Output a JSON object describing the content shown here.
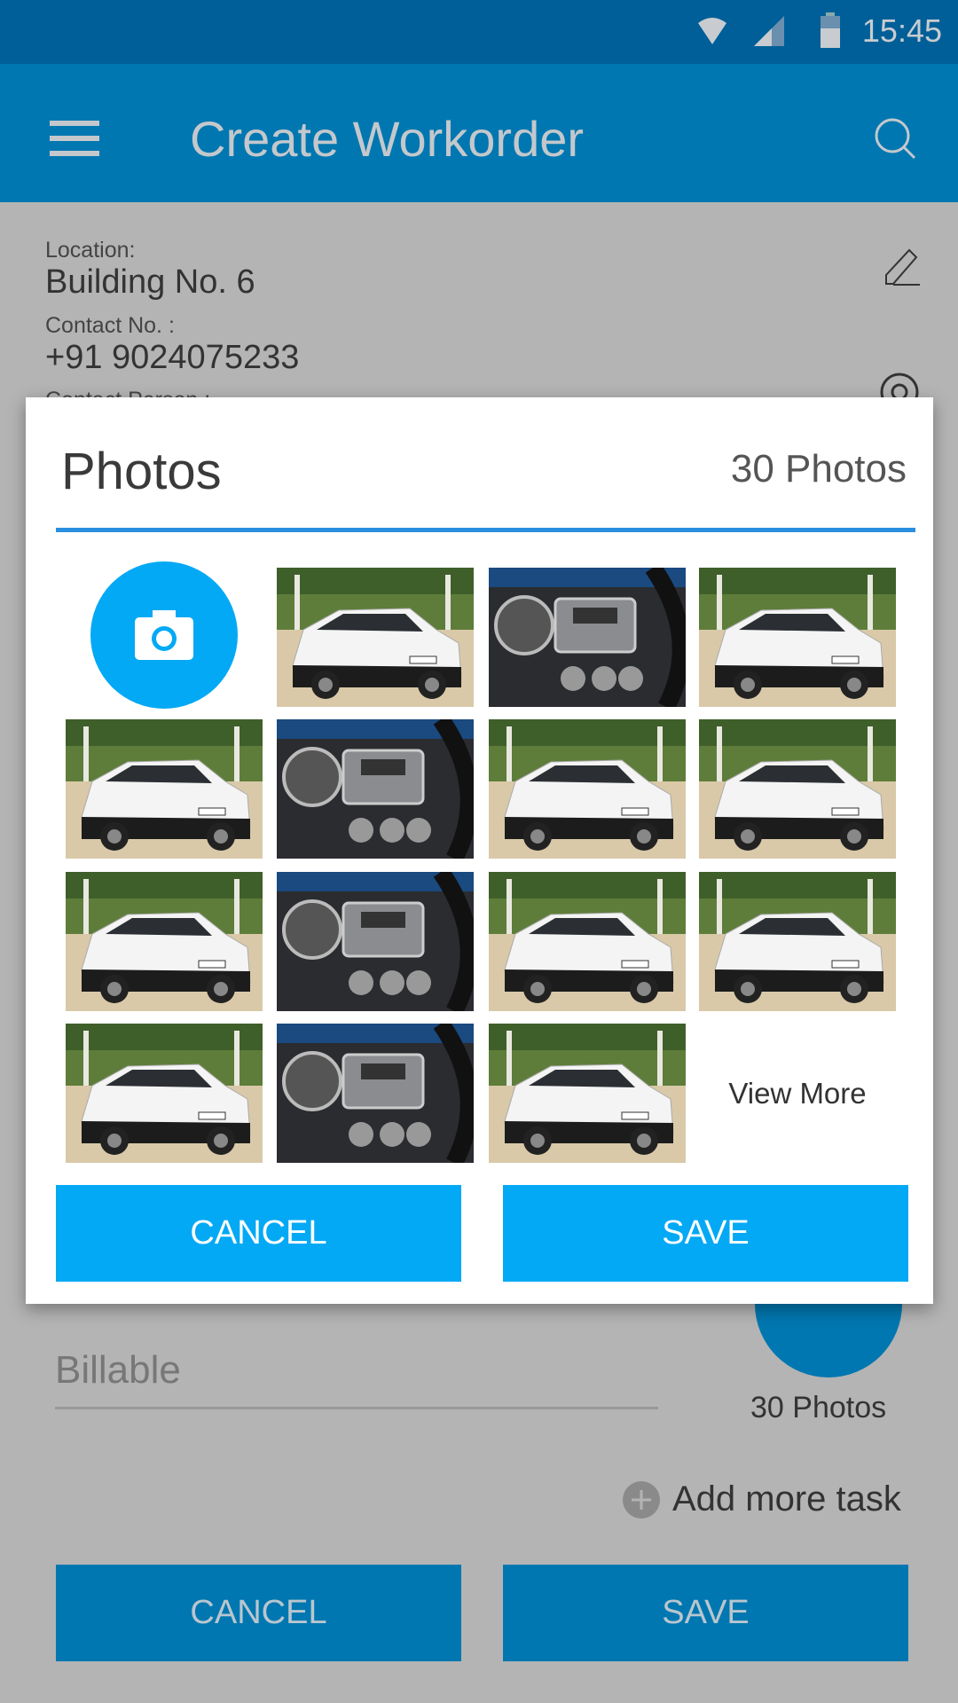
{
  "status_bar": {
    "time": "15:45",
    "icons": [
      "wifi-icon",
      "signal-icon",
      "battery-icon"
    ]
  },
  "app_bar": {
    "title": "Create Workorder",
    "menu_icon": "hamburger-menu-icon",
    "search_icon": "search-icon"
  },
  "details": {
    "location_label": "Location:",
    "location_value": "Building No. 6",
    "contact_no_label": "Contact No. :",
    "contact_no_value": "+91 9024075233",
    "contact_person_label": "Contact Person :"
  },
  "form": {
    "billable_placeholder": "Billable",
    "photos_count": "30 Photos",
    "add_task": "Add more task",
    "cancel": "CANCEL",
    "save": "SAVE"
  },
  "dialog": {
    "title": "Photos",
    "count": "30 Photos",
    "view_more": "View More",
    "cancel": "CANCEL",
    "save": "SAVE",
    "grid": [
      [
        "camera",
        "car",
        "dashboard",
        "car"
      ],
      [
        "car",
        "dashboard",
        "car",
        "car"
      ],
      [
        "car",
        "dashboard",
        "car",
        "car"
      ],
      [
        "car",
        "dashboard",
        "car",
        "view-more"
      ]
    ]
  },
  "colors": {
    "accent": "#03a9f4",
    "app_bar": "#0077b0",
    "divider": "#2a8fe0"
  }
}
